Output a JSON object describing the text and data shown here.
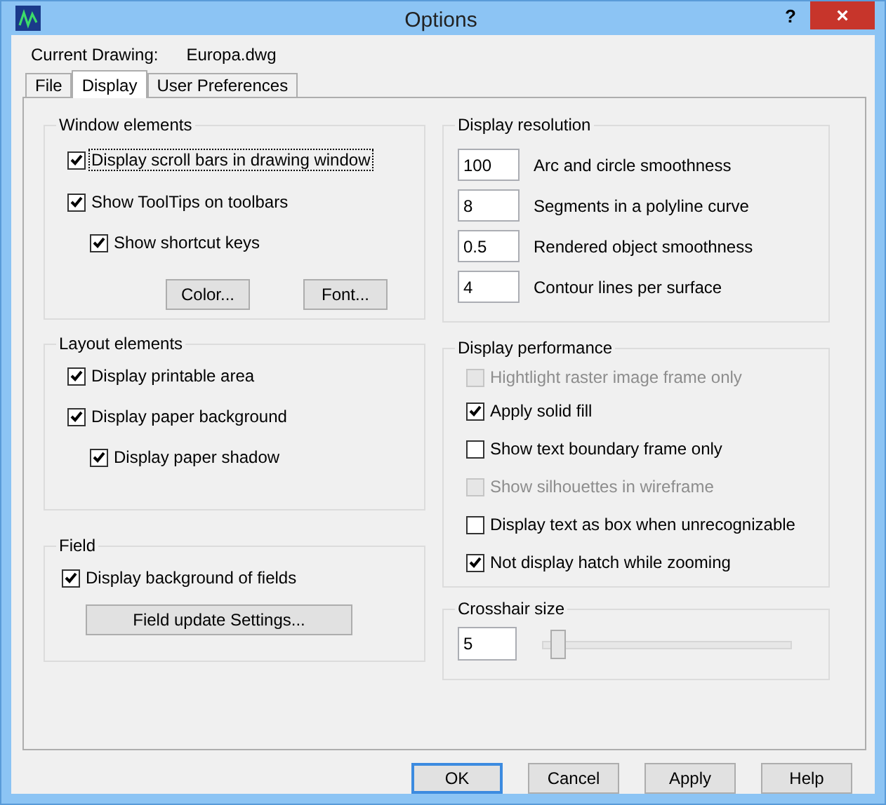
{
  "window": {
    "title": "Options",
    "buttons": [
      "?",
      "×"
    ]
  },
  "current_drawing": {
    "label": "Current Drawing:",
    "value": "Europa.dwg"
  },
  "tabs": [
    {
      "label": "File",
      "selected": false
    },
    {
      "label": "Display",
      "selected": true
    },
    {
      "label": "User Preferences",
      "selected": false
    }
  ],
  "window_elements": {
    "title": "Window elements",
    "items": [
      {
        "label": "Display scroll bars in drawing window",
        "checked": true,
        "focused": true
      },
      {
        "label": "Show ToolTips on toolbars",
        "checked": true,
        "focused": false,
        "children": [
          {
            "label": "Show shortcut keys",
            "checked": true,
            "focused": false
          }
        ]
      }
    ],
    "buttons": [
      "Color...",
      "Font..."
    ]
  },
  "layout_elements": {
    "title": "Layout elements",
    "items": [
      {
        "label": "Display printable area",
        "checked": true
      },
      {
        "label": "Display paper background",
        "checked": true,
        "children": [
          {
            "label": "Display paper shadow",
            "checked": true
          }
        ]
      }
    ]
  },
  "field": {
    "title": "Field",
    "items": [
      {
        "label": "Display background of fields",
        "checked": true
      }
    ],
    "button": "Field update Settings..."
  },
  "display_resolution": {
    "title": "Display resolution",
    "rows": [
      {
        "value": "100",
        "label": "Arc and circle smoothness"
      },
      {
        "value": "8",
        "label": "Segments in a polyline curve"
      },
      {
        "value": "0.5",
        "label": "Rendered object smoothness"
      },
      {
        "value": "4",
        "label": "Contour lines per surface"
      }
    ]
  },
  "display_performance": {
    "title": "Display performance",
    "items": [
      {
        "label": "Hightlight raster image frame only",
        "checked": false,
        "disabled": true
      },
      {
        "label": "Apply solid fill",
        "checked": true,
        "disabled": false
      },
      {
        "label": "Show text boundary frame only",
        "checked": false,
        "disabled": false
      },
      {
        "label": "Show silhouettes in wireframe",
        "checked": false,
        "disabled": true
      },
      {
        "label": "Display text as box when unrecognizable",
        "checked": false,
        "disabled": false
      },
      {
        "label": "Not display hatch while zooming",
        "checked": true,
        "disabled": false
      }
    ]
  },
  "crosshair_size": {
    "title": "Crosshair size",
    "value": "5",
    "level": 0.06
  },
  "buttons": [
    {
      "label": "OK",
      "default": true
    },
    {
      "label": "Cancel",
      "default": false
    },
    {
      "label": "Apply",
      "default": false
    },
    {
      "label": "Help",
      "default": false
    }
  ]
}
